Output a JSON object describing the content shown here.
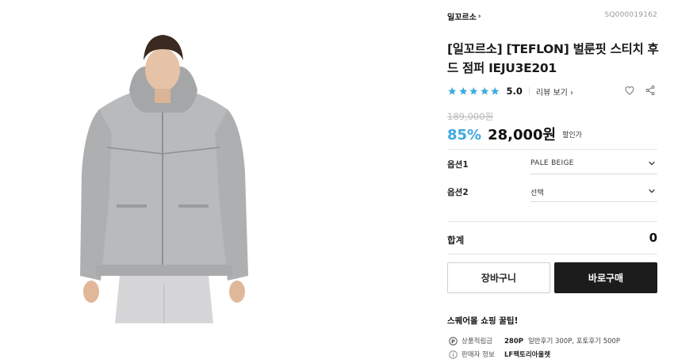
{
  "brand": {
    "name": "일꼬르소",
    "chevron": "›"
  },
  "product_code": "SQ000019162",
  "title": "[일꼬르소] [TEFLON] 벌룬핏 스티치 후드 점퍼 IEJU3E201",
  "rating": {
    "stars": 5,
    "score": "5.0",
    "review_link": "리뷰 보기",
    "review_chevron": "›"
  },
  "price": {
    "original": "189,000원",
    "discount": "85%",
    "sale": "28,000원",
    "sale_tag": "할인가"
  },
  "options": [
    {
      "label": "옵션1",
      "value": "PALE BEIGE"
    },
    {
      "label": "옵션2",
      "value": "선택"
    }
  ],
  "total": {
    "label": "합계",
    "value": "0"
  },
  "buttons": {
    "cart": "장바구니",
    "buy": "바로구매"
  },
  "tips": {
    "title": "스퀘어몰 쇼핑 꿀팁!",
    "points": {
      "label": "상품적립금",
      "value": "280P",
      "detail": "일반후기 300P, 포토후기 500P"
    },
    "seller": {
      "label": "판매자 정보",
      "value": "LF팩토리아울렛"
    }
  },
  "colors": {
    "accent": "#3fa9e0",
    "star": "#3fa9e0",
    "buy_button": "#1c1c1c"
  },
  "icons": [
    "heart-icon",
    "share-icon",
    "point-icon",
    "info-icon",
    "chevron-down-icon",
    "star-icon"
  ]
}
